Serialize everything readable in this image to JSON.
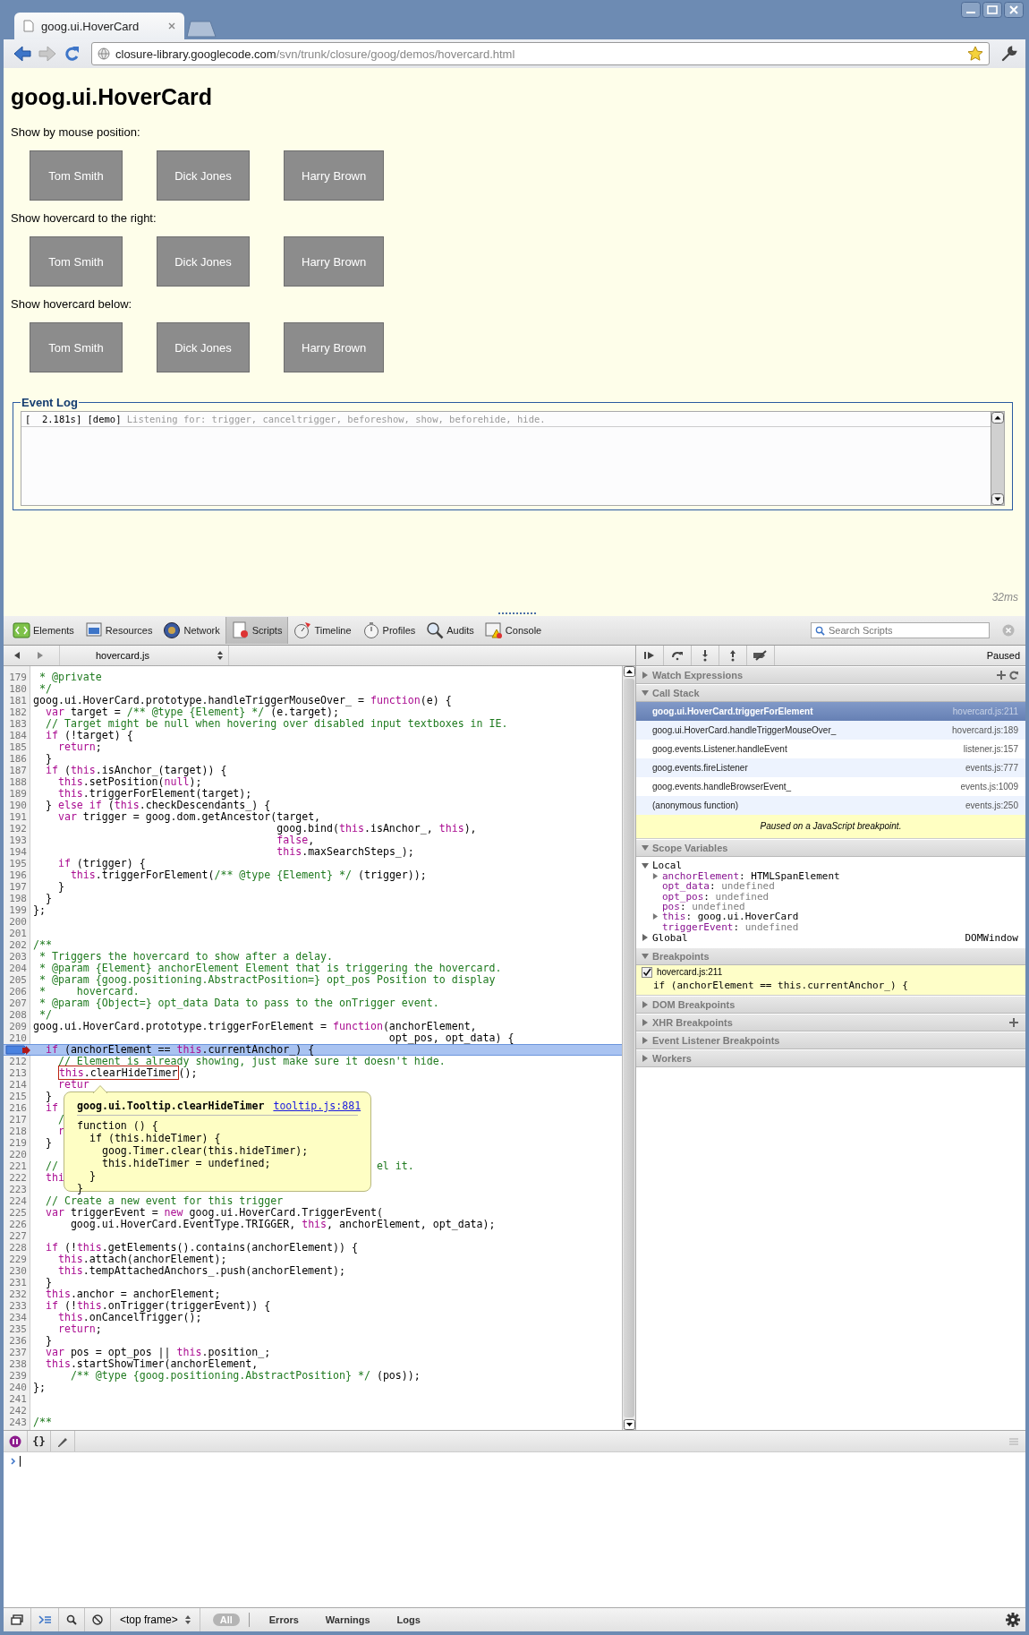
{
  "window": {
    "tab_title": "goog.ui.HoverCard"
  },
  "address_bar": {
    "host": "closure-library.googlecode.com",
    "path": "/svn/trunk/closure/goog/demos/hovercard.html"
  },
  "page": {
    "title": "goog.ui.HoverCard",
    "sections": [
      {
        "label": "Show by mouse position:",
        "buttons": [
          "Tom Smith",
          "Dick Jones",
          "Harry Brown"
        ]
      },
      {
        "label": "Show hovercard to the right:",
        "buttons": [
          "Tom Smith",
          "Dick Jones",
          "Harry Brown"
        ]
      },
      {
        "label": "Show hovercard below:",
        "buttons": [
          "Tom Smith",
          "Dick Jones",
          "Harry Brown"
        ]
      }
    ],
    "event_log": {
      "legend": "Event Log",
      "entries": [
        {
          "time": "[  2.181s]",
          "source": "[demo]",
          "message": "Listening for: trigger, canceltrigger, beforeshow, show, beforehide, hide."
        }
      ]
    },
    "timing": "32ms"
  },
  "devtools": {
    "panels": [
      {
        "label": "Elements",
        "selected": false
      },
      {
        "label": "Resources",
        "selected": false
      },
      {
        "label": "Network",
        "selected": false
      },
      {
        "label": "Scripts",
        "selected": true
      },
      {
        "label": "Timeline",
        "selected": false
      },
      {
        "label": "Profiles",
        "selected": false
      },
      {
        "label": "Audits",
        "selected": false
      },
      {
        "label": "Console",
        "selected": false
      }
    ],
    "search": {
      "placeholder": "Search Scripts"
    },
    "scripts": {
      "file": "hovercard.js",
      "lines": [
        {
          "number": "179",
          "tokens": [
            {
              "kind": "comment",
              "text": " * @private"
            }
          ]
        },
        {
          "number": "180",
          "tokens": [
            {
              "kind": "comment",
              "text": " */"
            }
          ]
        },
        {
          "number": "181",
          "tokens": [
            {
              "kind": "plain",
              "text": "goog.ui.HoverCard.prototype.handleTriggerMouseOver_ = "
            },
            {
              "kind": "keyword",
              "text": "function"
            },
            {
              "kind": "plain",
              "text": "(e) {"
            }
          ]
        },
        {
          "number": "182",
          "tokens": [
            {
              "kind": "keyword",
              "text": "  var"
            },
            {
              "kind": "plain",
              "text": " target = "
            },
            {
              "kind": "comment",
              "text": "/** @type {Element} */"
            },
            {
              "kind": "plain",
              "text": " (e.target);"
            }
          ]
        },
        {
          "number": "183",
          "tokens": [
            {
              "kind": "comment",
              "text": "  // Target might be null when hovering over disabled input textboxes in IE."
            }
          ]
        },
        {
          "number": "184",
          "tokens": [
            {
              "kind": "keyword",
              "text": "  if"
            },
            {
              "kind": "plain",
              "text": " (!target) {"
            }
          ]
        },
        {
          "number": "185",
          "tokens": [
            {
              "kind": "keyword",
              "text": "    return"
            },
            {
              "kind": "plain",
              "text": ";"
            }
          ]
        },
        {
          "number": "186",
          "tokens": [
            {
              "kind": "plain",
              "text": "  }"
            }
          ]
        },
        {
          "number": "187",
          "tokens": [
            {
              "kind": "keyword",
              "text": "  if"
            },
            {
              "kind": "plain",
              "text": " ("
            },
            {
              "kind": "keyword",
              "text": "this"
            },
            {
              "kind": "plain",
              "text": ".isAnchor_(target)) {"
            }
          ]
        },
        {
          "number": "188",
          "tokens": [
            {
              "kind": "keyword",
              "text": "    this"
            },
            {
              "kind": "plain",
              "text": ".setPosition("
            },
            {
              "kind": "keyword",
              "text": "null"
            },
            {
              "kind": "plain",
              "text": ");"
            }
          ]
        },
        {
          "number": "189",
          "tokens": [
            {
              "kind": "keyword",
              "text": "    this"
            },
            {
              "kind": "plain",
              "text": ".triggerForElement(target);"
            }
          ]
        },
        {
          "number": "190",
          "tokens": [
            {
              "kind": "plain",
              "text": "  } "
            },
            {
              "kind": "keyword",
              "text": "else if"
            },
            {
              "kind": "plain",
              "text": " ("
            },
            {
              "kind": "keyword",
              "text": "this"
            },
            {
              "kind": "plain",
              "text": ".checkDescendants_) {"
            }
          ]
        },
        {
          "number": "191",
          "tokens": [
            {
              "kind": "keyword",
              "text": "    var"
            },
            {
              "kind": "plain",
              "text": " trigger = goog.dom.getAncestor(target,"
            }
          ]
        },
        {
          "number": "192",
          "tokens": [
            {
              "kind": "plain",
              "text": "                                       goog.bind("
            },
            {
              "kind": "keyword",
              "text": "this"
            },
            {
              "kind": "plain",
              "text": ".isAnchor_, "
            },
            {
              "kind": "keyword",
              "text": "this"
            },
            {
              "kind": "plain",
              "text": "),"
            }
          ]
        },
        {
          "number": "193",
          "tokens": [
            {
              "kind": "keyword",
              "text": "                                       false"
            },
            {
              "kind": "plain",
              "text": ","
            }
          ]
        },
        {
          "number": "194",
          "tokens": [
            {
              "kind": "keyword",
              "text": "                                       this"
            },
            {
              "kind": "plain",
              "text": ".maxSearchSteps_);"
            }
          ]
        },
        {
          "number": "195",
          "tokens": [
            {
              "kind": "keyword",
              "text": "    if"
            },
            {
              "kind": "plain",
              "text": " (trigger) {"
            }
          ]
        },
        {
          "number": "196",
          "tokens": [
            {
              "kind": "keyword",
              "text": "      this"
            },
            {
              "kind": "plain",
              "text": ".triggerForElement("
            },
            {
              "kind": "comment",
              "text": "/** @type {Element} */"
            },
            {
              "kind": "plain",
              "text": " (trigger));"
            }
          ]
        },
        {
          "number": "197",
          "tokens": [
            {
              "kind": "plain",
              "text": "    }"
            }
          ]
        },
        {
          "number": "198",
          "tokens": [
            {
              "kind": "plain",
              "text": "  }"
            }
          ]
        },
        {
          "number": "199",
          "tokens": [
            {
              "kind": "plain",
              "text": "};"
            }
          ]
        },
        {
          "number": "200"
        },
        {
          "number": "201"
        },
        {
          "number": "202",
          "tokens": [
            {
              "kind": "comment",
              "text": "/**"
            }
          ]
        },
        {
          "number": "203",
          "tokens": [
            {
              "kind": "comment",
              "text": " * Triggers the hovercard to show after a delay."
            }
          ]
        },
        {
          "number": "204",
          "tokens": [
            {
              "kind": "comment",
              "text": " * @param {Element} anchorElement Element that is triggering the hovercard."
            }
          ]
        },
        {
          "number": "205",
          "tokens": [
            {
              "kind": "comment",
              "text": " * @param {goog.positioning.AbstractPosition=} opt_pos Position to display"
            }
          ]
        },
        {
          "number": "206",
          "tokens": [
            {
              "kind": "comment",
              "text": " *     hovercard."
            }
          ]
        },
        {
          "number": "207",
          "tokens": [
            {
              "kind": "comment",
              "text": " * @param {Object=} opt_data Data to pass to the onTrigger event."
            }
          ]
        },
        {
          "number": "208",
          "tokens": [
            {
              "kind": "comment",
              "text": " */"
            }
          ]
        },
        {
          "number": "209",
          "tokens": [
            {
              "kind": "plain",
              "text": "goog.ui.HoverCard.prototype.triggerForElement = "
            },
            {
              "kind": "keyword",
              "text": "function"
            },
            {
              "kind": "plain",
              "text": "(anchorElement,"
            }
          ]
        },
        {
          "number": "210",
          "tokens": [
            {
              "kind": "plain",
              "text": "                                                         opt_pos, opt_data) {"
            }
          ]
        },
        {
          "breakpoint": true,
          "current": true,
          "tokens": [
            {
              "kind": "keyword",
              "text": "  if"
            },
            {
              "kind": "plain",
              "text": " (anchorElement == "
            },
            {
              "kind": "keyword",
              "text": "this"
            },
            {
              "kind": "plain",
              "text": ".currentAnchor_) {"
            }
          ]
        },
        {
          "number": "212",
          "tokens": [
            {
              "kind": "comment",
              "text": "    // Element is already showing, just make sure it doesn't hide."
            }
          ]
        },
        {
          "number": "213",
          "tokens": [
            {
              "kind": "keyword",
              "text": "    this",
              "hovered": true
            },
            {
              "kind": "plain",
              "text": ".clearHideTimer",
              "hovered": true
            },
            {
              "kind": "plain",
              "text": "();"
            }
          ]
        },
        {
          "number": "214",
          "tokens": [
            {
              "kind": "keyword",
              "text": "    retur"
            }
          ]
        },
        {
          "number": "215",
          "tokens": [
            {
              "kind": "plain",
              "text": "  }"
            }
          ]
        },
        {
          "number": "216",
          "tokens": [
            {
              "kind": "keyword",
              "text": "  if"
            }
          ]
        },
        {
          "number": "217",
          "tokens": [
            {
              "kind": "comment",
              "text": "    /"
            }
          ]
        },
        {
          "number": "218",
          "tokens": [
            {
              "kind": "keyword",
              "text": "    r"
            }
          ]
        },
        {
          "number": "219",
          "tokens": [
            {
              "kind": "plain",
              "text": "  }"
            }
          ]
        },
        {
          "number": "220"
        },
        {
          "number": "221",
          "tokens": [
            {
              "kind": "comment",
              "text": "  //"
            },
            {
              "kind": "comment",
              "text": "el it.",
              "after_tooltip": true
            }
          ]
        },
        {
          "number": "222",
          "tokens": [
            {
              "kind": "keyword",
              "text": "  thi"
            }
          ]
        },
        {
          "number": "223"
        },
        {
          "number": "224",
          "tokens": [
            {
              "kind": "comment",
              "text": "  // Create a new event for this trigger"
            }
          ]
        },
        {
          "number": "225",
          "tokens": [
            {
              "kind": "keyword",
              "text": "  var"
            },
            {
              "kind": "plain",
              "text": " triggerEvent = "
            },
            {
              "kind": "keyword",
              "text": "new"
            },
            {
              "kind": "plain",
              "text": " goog.ui.HoverCard.TriggerEvent("
            }
          ]
        },
        {
          "number": "226",
          "tokens": [
            {
              "kind": "plain",
              "text": "      goog.ui.HoverCard.EventType.TRIGGER, "
            },
            {
              "kind": "keyword",
              "text": "this"
            },
            {
              "kind": "plain",
              "text": ", anchorElement, opt_data);"
            }
          ]
        },
        {
          "number": "227"
        },
        {
          "number": "228",
          "tokens": [
            {
              "kind": "keyword",
              "text": "  if"
            },
            {
              "kind": "plain",
              "text": " (!"
            },
            {
              "kind": "keyword",
              "text": "this"
            },
            {
              "kind": "plain",
              "text": ".getElements().contains(anchorElement)) {"
            }
          ]
        },
        {
          "number": "229",
          "tokens": [
            {
              "kind": "keyword",
              "text": "    this"
            },
            {
              "kind": "plain",
              "text": ".attach(anchorElement);"
            }
          ]
        },
        {
          "number": "230",
          "tokens": [
            {
              "kind": "keyword",
              "text": "    this"
            },
            {
              "kind": "plain",
              "text": ".tempAttachedAnchors_.push(anchorElement);"
            }
          ]
        },
        {
          "number": "231",
          "tokens": [
            {
              "kind": "plain",
              "text": "  }"
            }
          ]
        },
        {
          "number": "232",
          "tokens": [
            {
              "kind": "keyword",
              "text": "  this"
            },
            {
              "kind": "plain",
              "text": ".anchor = anchorElement;"
            }
          ]
        },
        {
          "number": "233",
          "tokens": [
            {
              "kind": "keyword",
              "text": "  if"
            },
            {
              "kind": "plain",
              "text": " (!"
            },
            {
              "kind": "keyword",
              "text": "this"
            },
            {
              "kind": "plain",
              "text": ".onTrigger(triggerEvent)) {"
            }
          ]
        },
        {
          "number": "234",
          "tokens": [
            {
              "kind": "keyword",
              "text": "    this"
            },
            {
              "kind": "plain",
              "text": ".onCancelTrigger();"
            }
          ]
        },
        {
          "number": "235",
          "tokens": [
            {
              "kind": "keyword",
              "text": "    return"
            },
            {
              "kind": "plain",
              "text": ";"
            }
          ]
        },
        {
          "number": "236",
          "tokens": [
            {
              "kind": "plain",
              "text": "  }"
            }
          ]
        },
        {
          "number": "237",
          "tokens": [
            {
              "kind": "keyword",
              "text": "  var"
            },
            {
              "kind": "plain",
              "text": " pos = opt_pos || "
            },
            {
              "kind": "keyword",
              "text": "this"
            },
            {
              "kind": "plain",
              "text": ".position_;"
            }
          ]
        },
        {
          "number": "238",
          "tokens": [
            {
              "kind": "keyword",
              "text": "  this"
            },
            {
              "kind": "plain",
              "text": ".startShowTimer(anchorElement,"
            }
          ]
        },
        {
          "number": "239",
          "tokens": [
            {
              "kind": "comment",
              "text": "      /** @type {goog.positioning.AbstractPosition} */"
            },
            {
              "kind": "plain",
              "text": " (pos));"
            }
          ]
        },
        {
          "number": "240",
          "tokens": [
            {
              "kind": "plain",
              "text": "};"
            }
          ]
        },
        {
          "number": "241"
        },
        {
          "number": "242"
        },
        {
          "number": "243",
          "tokens": [
            {
              "kind": "comment",
              "text": "/**"
            }
          ]
        }
      ],
      "tooltip": {
        "title": "goog.ui.Tooltip.clearHideTimer",
        "link": "tooltip.js:881",
        "code": [
          "function () {",
          "  if (this.hideTimer) {",
          "    goog.Timer.clear(this.hideTimer);",
          "    this.hideTimer = undefined;",
          "  }",
          "}"
        ]
      }
    },
    "debugger": {
      "status": "Paused",
      "sections": [
        {
          "kind": "watch",
          "title": "Watch Expressions",
          "expanded": false
        },
        {
          "kind": "callstack",
          "title": "Call Stack",
          "expanded": true,
          "frames": [
            {
              "name": "goog.ui.HoverCard.triggerForElement",
              "location": "hovercard.js:211",
              "selected": true
            },
            {
              "name": "goog.ui.HoverCard.handleTriggerMouseOver_",
              "location": "hovercard.js:189",
              "selected": false
            },
            {
              "name": "goog.events.Listener.handleEvent",
              "location": "listener.js:157",
              "selected": false
            },
            {
              "name": "goog.events.fireListener",
              "location": "events.js:777",
              "selected": false
            },
            {
              "name": "goog.events.handleBrowserEvent_",
              "location": "events.js:1009",
              "selected": false
            },
            {
              "name": "(anonymous function)",
              "location": "events.js:250",
              "selected": false
            }
          ],
          "message": "Paused on a JavaScript breakpoint."
        },
        {
          "kind": "scope",
          "title": "Scope Variables",
          "expanded": true,
          "scopes": [
            {
              "name": "Local",
              "expanded": true,
              "separator": ":",
              "properties": [
                {
                  "name": "anchorElement",
                  "value": "HTMLSpanElement",
                  "expandable": true,
                  "undefined": false
                },
                {
                  "name": "opt_data",
                  "value": "undefined",
                  "expandable": false,
                  "undefined": true
                },
                {
                  "name": "opt_pos",
                  "value": "undefined",
                  "expandable": false,
                  "undefined": true
                },
                {
                  "name": "pos",
                  "value": "undefined",
                  "expandable": false,
                  "undefined": true
                },
                {
                  "name": "this",
                  "value": "goog.ui.HoverCard",
                  "expandable": true,
                  "undefined": false
                },
                {
                  "name": "triggerEvent",
                  "value": "undefined",
                  "expandable": false,
                  "undefined": true
                }
              ]
            },
            {
              "name": "Global",
              "expanded": false,
              "value": "DOMWindow"
            }
          ]
        },
        {
          "kind": "breakpoints",
          "title": "Breakpoints",
          "expanded": true,
          "items": [
            {
              "location": "hovercard.js:211",
              "code": "if (anchorElement == this.currentAnchor_) {",
              "checked": true
            }
          ]
        },
        {
          "kind": "plain",
          "title": "DOM Breakpoints",
          "expanded": false
        },
        {
          "kind": "xhr",
          "title": "XHR Breakpoints",
          "expanded": false
        },
        {
          "kind": "plain",
          "title": "Event Listener Breakpoints",
          "expanded": false
        },
        {
          "kind": "plain",
          "title": "Workers",
          "expanded": false
        }
      ]
    },
    "console": {
      "pretty_print": "{}"
    },
    "console_bar": {
      "frame": "<top frame>",
      "filters": [
        {
          "label": "All",
          "selected": true
        },
        {
          "label": "Errors",
          "selected": false
        },
        {
          "label": "Warnings",
          "selected": false
        },
        {
          "label": "Logs",
          "selected": false
        }
      ]
    }
  }
}
